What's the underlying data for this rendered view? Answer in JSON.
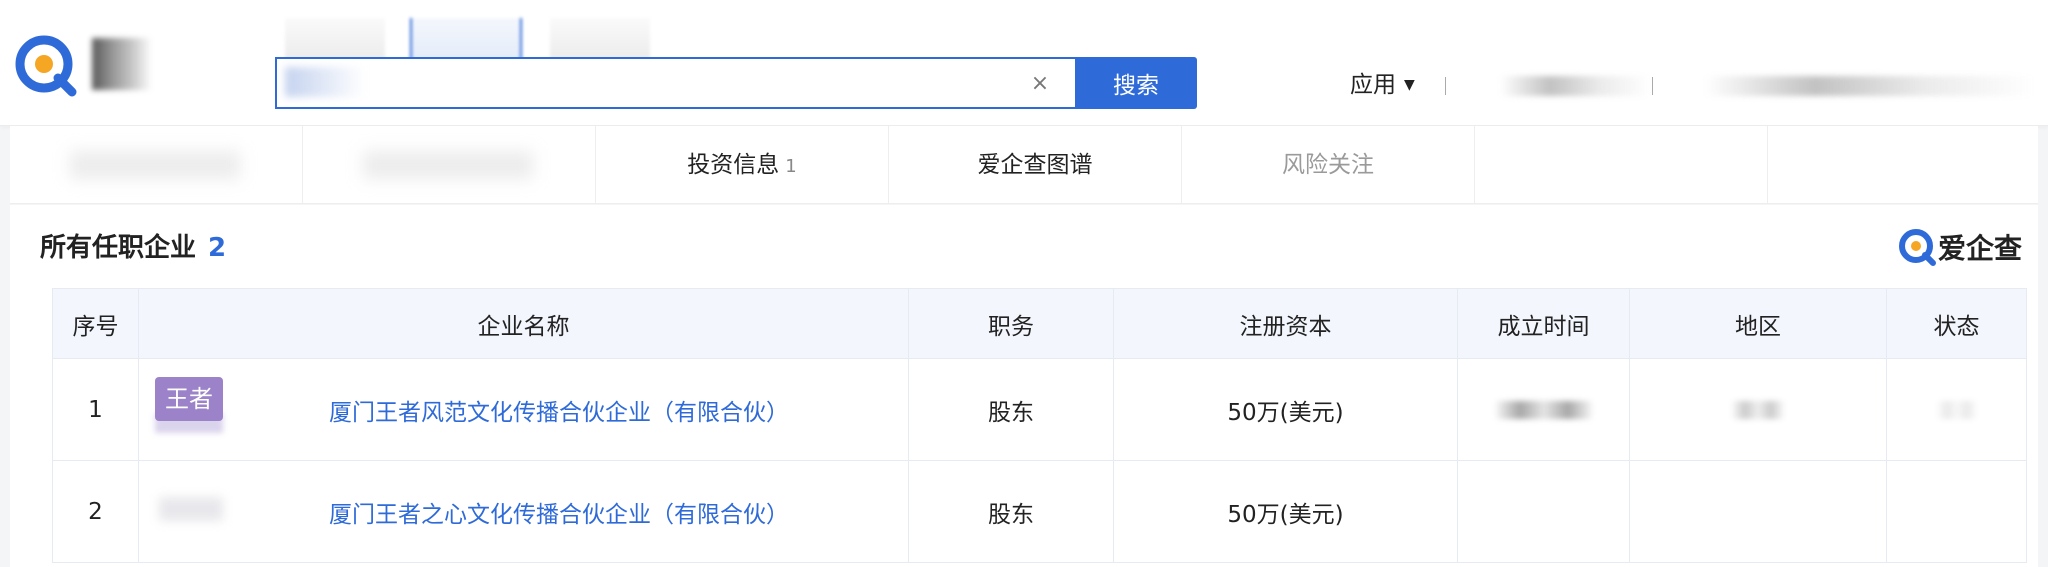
{
  "header": {
    "search": {
      "value": "",
      "placeholder": "",
      "clear_glyph": "×",
      "button_label": "搜索"
    },
    "apps_label": "应用",
    "caret_glyph": "▼"
  },
  "tabs": [
    {
      "label": ""
    },
    {
      "label": ""
    },
    {
      "label": "投资信息",
      "count": "1"
    },
    {
      "label": "爱企查图谱"
    },
    {
      "label": "风险关注"
    },
    {
      "label": ""
    },
    {
      "label": ""
    }
  ],
  "section": {
    "title": "所有任职企业",
    "count": "2"
  },
  "brand": {
    "name": "爱企查"
  },
  "table": {
    "columns": [
      "序号",
      "企业名称",
      "职务",
      "注册资本",
      "成立时间",
      "地区",
      "状态"
    ],
    "rows": [
      {
        "index": "1",
        "logo_text": "王者",
        "name": "厦门王者风范文化传播合伙企业（有限合伙）",
        "role": "股东",
        "capital": "50万(美元)"
      },
      {
        "index": "2",
        "logo_text": "",
        "name": "厦门王者之心文化传播合伙企业（有限合伙）",
        "role": "股东",
        "capital": "50万(美元)"
      }
    ]
  },
  "colors": {
    "accent": "#2f6bd8",
    "logo_purple": "#9b82c9",
    "table_header_bg": "#f3f7fd"
  },
  "icons": {
    "logo": "magnifier-q-logo-icon",
    "brand": "aiqicha-q-icon",
    "clear": "close-icon",
    "caret": "caret-down-icon"
  }
}
